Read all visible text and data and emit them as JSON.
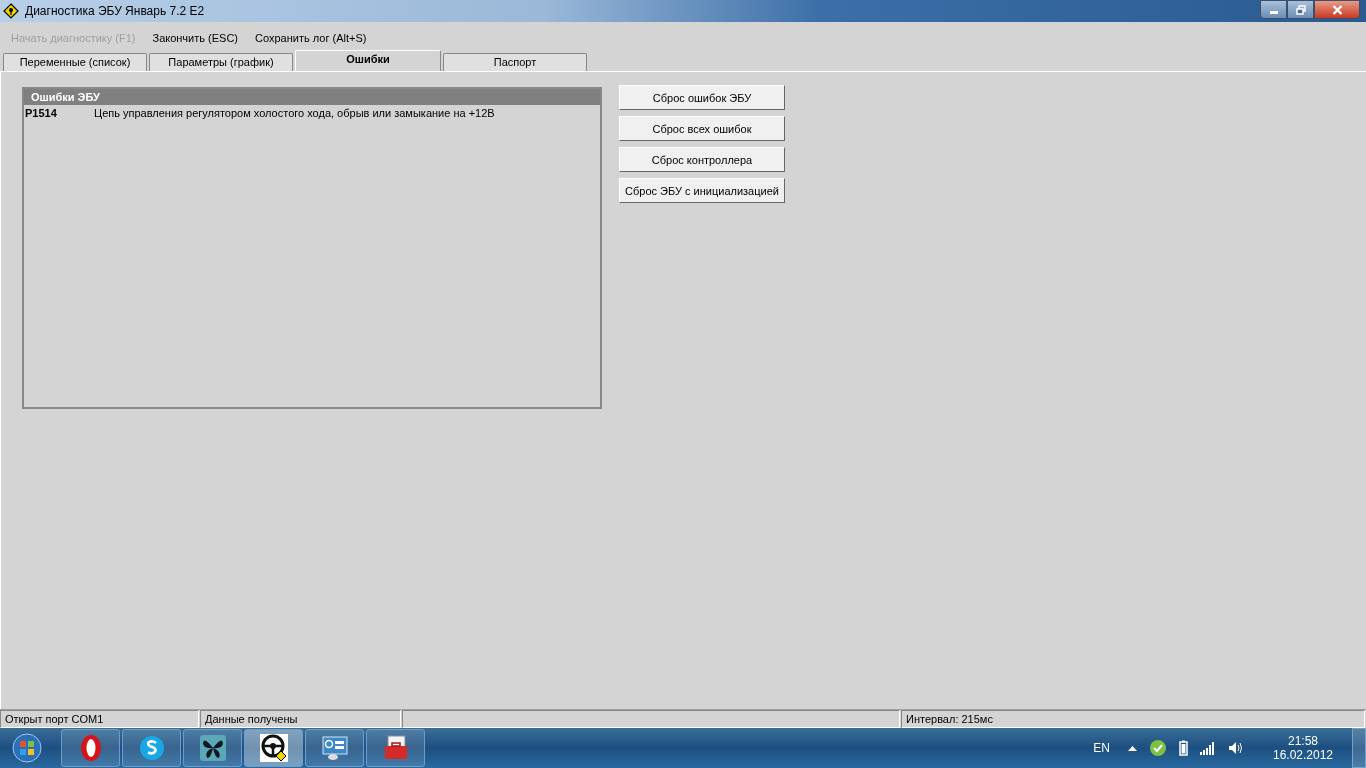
{
  "window": {
    "title": "Диагностика ЭБУ Январь 7.2 E2"
  },
  "menu": [
    {
      "label": "Начать диагностику (F1)",
      "disabled": true
    },
    {
      "label": "Закончить (ESC)",
      "disabled": false
    },
    {
      "label": "Сохранить лог (Alt+S)",
      "disabled": false
    }
  ],
  "tabs": [
    {
      "label": "Переменные (список)",
      "selected": false
    },
    {
      "label": "Параметры (график)",
      "selected": false
    },
    {
      "label": "Ошибки",
      "selected": true
    },
    {
      "label": "Паспорт",
      "selected": false
    }
  ],
  "errors_panel": {
    "title": "Ошибки ЭБУ",
    "rows": [
      {
        "code": "P1514",
        "description": "Цепь управления регулятором холостого хода, обрыв или замыкание на +12В"
      }
    ]
  },
  "buttons": [
    "Сброс ошибок ЭБУ",
    "Сброс всех ошибок",
    "Сброс контроллера",
    "Сброс ЭБУ с инициализацией"
  ],
  "status_bar": [
    "Открыт порт COM1",
    "Данные получены",
    "Интервал: 215мс"
  ],
  "taskbar": {
    "apps": [
      {
        "kind": "opera",
        "selected": false
      },
      {
        "kind": "skype",
        "selected": false
      },
      {
        "kind": "butterfly",
        "selected": false
      },
      {
        "kind": "wheel",
        "selected": true
      },
      {
        "kind": "panel",
        "selected": false
      },
      {
        "kind": "toolbox",
        "selected": false
      }
    ],
    "language": "EN",
    "time": "21:58",
    "date": "16.02.2012"
  }
}
